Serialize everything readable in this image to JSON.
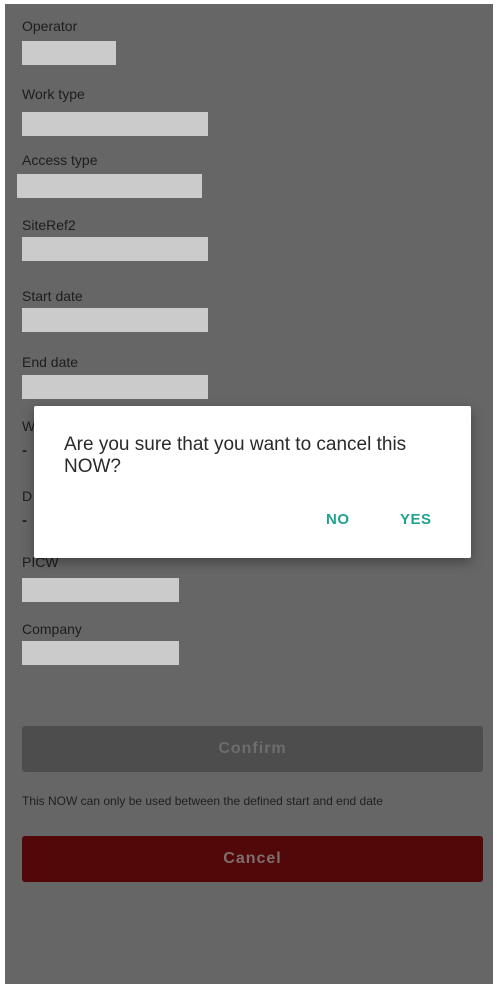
{
  "fields": [
    {
      "label": "Operator"
    },
    {
      "label": "Work type"
    },
    {
      "label": "Access type"
    },
    {
      "label": "SiteRef2"
    },
    {
      "label": "Start date"
    },
    {
      "label": "End date"
    },
    {
      "label": "W"
    },
    {
      "label": "D"
    },
    {
      "label": "PICW"
    },
    {
      "label": "Company"
    }
  ],
  "partial_values": {
    "dash_1": "-",
    "dash_2": "-"
  },
  "buttons": {
    "confirm": "Confirm",
    "cancel": "Cancel"
  },
  "hint": "This NOW can only be used between the defined start and end date",
  "dialog": {
    "message": "Are you sure that you want to cancel this NOW?",
    "no": "NO",
    "yes": "YES"
  },
  "colors": {
    "scrim_background": "#666666",
    "dialog_accent": "#1fa38f",
    "cancel_button": "#520808"
  }
}
